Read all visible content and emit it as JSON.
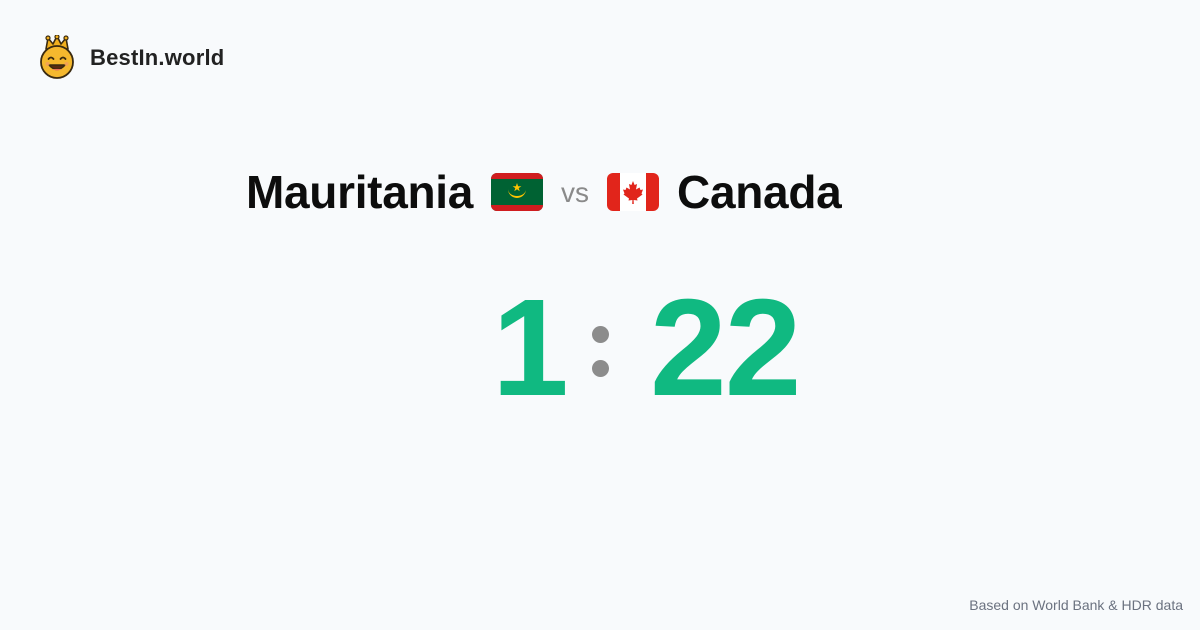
{
  "brand": {
    "name": "BestIn.world",
    "logo_icon": "crowned-smiley-icon"
  },
  "matchup": {
    "left_country": "Mauritania",
    "left_flag_icon": "mauritania-flag-icon",
    "vs_label": "vs",
    "right_country": "Canada",
    "right_flag_icon": "canada-flag-icon"
  },
  "score": {
    "left": "1",
    "right": "22",
    "separator_icon": "colon-icon"
  },
  "footer": {
    "note": "Based on World Bank & HDR data"
  },
  "colors": {
    "background": "#f8fafc",
    "score": "#10b981",
    "separator": "#8c8c8c",
    "vs": "#8a8a8a",
    "text": "#0d0d0d",
    "footer": "#6b7280",
    "logo_face": "#f5b82e",
    "mauritania_green": "#006233",
    "mauritania_red": "#d01c1f",
    "mauritania_gold": "#ffc400",
    "canada_red": "#e1251b"
  }
}
